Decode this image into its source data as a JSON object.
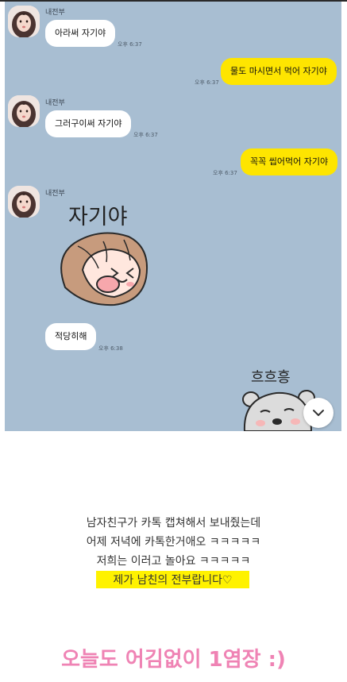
{
  "chat": {
    "sender_name": "내전부",
    "messages": {
      "m1": {
        "text": "아라써 자기야",
        "time": "오후 6:37"
      },
      "m2": {
        "text": "물도 마시면서 먹어 자기야",
        "time": "오후 6:37"
      },
      "m3": {
        "text": "그러구이써 자기야",
        "time": "오후 6:37"
      },
      "m4": {
        "text": "꼭꼭 씹어먹어 자기야",
        "time": "오후 6:37"
      },
      "m5": {
        "text": "적당히해",
        "time": "오후 6:38"
      }
    },
    "sticker_text": "자기야",
    "sticker2_text": "흐흐흥"
  },
  "caption": {
    "line1": "남자친구가 카톡 캡쳐해서 보내줬는데",
    "line2": "어제 저녁에 카톡한거애오 ㅋㅋㅋㅋㅋ",
    "line3": "저희는 이러고 놀아요 ㅋㅋㅋㅋㅋ",
    "highlight": "제가 남친의 전부랍니다♡"
  },
  "headline": "오늘도 어김없이 1염장 :)",
  "colors": {
    "chat_bg": "#a8bed2",
    "my_bubble": "#fee500",
    "headline": "#ef83b4",
    "highlight": "#fff200"
  },
  "icons": {
    "scroll_down": "chevron-down-icon"
  }
}
